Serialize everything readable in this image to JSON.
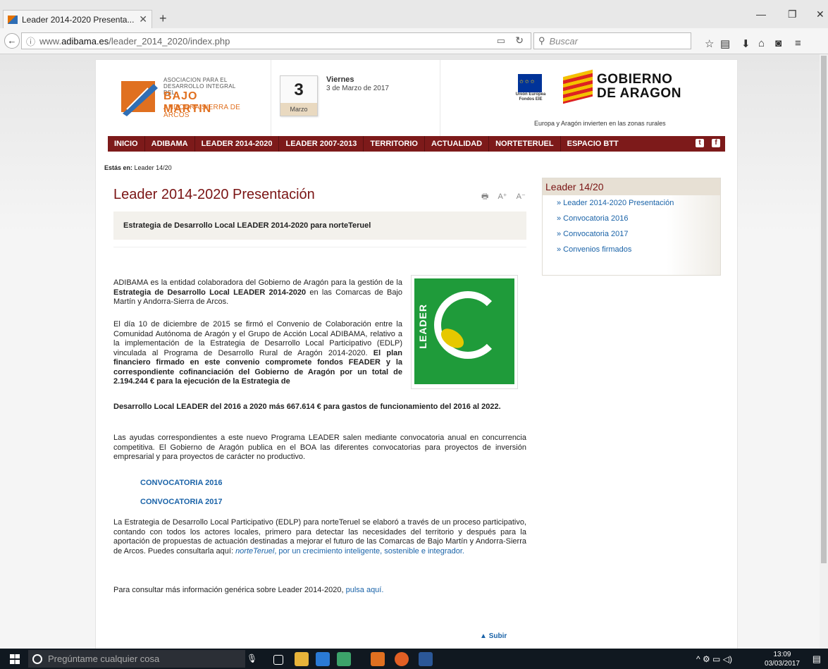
{
  "browser": {
    "tab_title": "Leader 2014-2020 Presenta...",
    "tab_close": "✕",
    "new_tab": "+",
    "url_prefix": "www.",
    "url_domain": "adibama.es",
    "url_path": "/leader_2014_2020/index.php",
    "search_placeholder": "Buscar",
    "win_min": "—",
    "win_max": "❐",
    "win_close": "✕"
  },
  "header": {
    "logo_small_1": "ASOCIACION PARA EL",
    "logo_small_2": "DESARROLLO INTEGRAL DEL",
    "logo_big": "BAJO MARTIN",
    "logo_sub": "ANDORRA SIERRA DE ARCOS",
    "cal_day": "3",
    "cal_month": "Marzo",
    "weekday": "Viernes",
    "full_date": "3 de Marzo de 2017",
    "eu_line1": "Unión Europea",
    "eu_line2": "Fondos EIE",
    "gob_line1": "GOBIERNO",
    "gob_line2": "DE ARAGON",
    "tagline": "Europa y Aragón invierten en las zonas rurales"
  },
  "menu": [
    "INICIO",
    "ADIBAMA",
    "LEADER 2014-2020",
    "LEADER 2007-2013",
    "TERRITORIO",
    "ACTUALIDAD",
    "NORTETERUEL",
    "ESPACIO BTT"
  ],
  "breadcrumb": {
    "label": "Estás en:",
    "current": "Leader 14/20"
  },
  "main": {
    "title": "Leader 2014-2020 Presentación",
    "tool_print": "🖶",
    "tool_bigger": "A⁺",
    "tool_smaller": "A⁻",
    "strategy": "Estrategia de Desarrollo Local LEADER 2014-2020 para norteTeruel",
    "leader_logo_text": "LEADER",
    "p1_a": "ADIBAMA es la entidad colaboradora del Gobierno de Aragón para la gestión de la ",
    "p1_b": "Estrategia de Desarrollo Local LEADER 2014-2020",
    "p1_c": " en las Comarcas de Bajo Martín y Andorra-Sierra de Arcos.",
    "p2_a": "El día 10 de diciembre de 2015 se firmó el Convenio de Colaboración entre la Comunidad Autónoma de Aragón y el Grupo de Acción Local ADIBAMA, relativo a la implementación de la Estrategia de Desarrollo Local Participativo (EDLP) vinculada al Programa de Desarrollo Rural de Aragón 2014-2020.  ",
    "p2_b": "El plan financiero firmado en este convenio compromete fondos FEADER y la correspondiente cofinanciación del Gobierno de Aragón por un total de 2.194.244 € para la ejecución de la Estrategia de",
    "p2_c": "Desarrollo Local LEADER del 2016 a 2020 más 667.614 € para gastos de funcionamiento del 2016 al 2022.",
    "p3": "Las ayudas correspondientes a este nuevo Programa LEADER salen mediante convocatoria anual en concurrencia competitiva.  El Gobierno de Aragón publica en el BOA las diferentes convocatorias para proyectos de inversión empresarial y para proyectos de carácter no productivo.",
    "conv_2016": "CONVOCATORIA 2016",
    "conv_2017": "CONVOCATORIA 2017",
    "p4_a": "La Estrategia de Desarrollo Local Participativo (EDLP) para norteTeruel se elaboró a través de un proceso participativo, contando con todos los actores locales, primero para detectar las necesidades del territorio y después para la aportación de propuestas de actuación destinadas a mejorar el futuro de las Comarcas de Bajo Martín y Andorra-Sierra de Arcos.  Puedes consultarla aquí:  ",
    "p4_link_a": "norteTeruel",
    "p4_link_b": ", por un crecimiento inteligente, sostenible e integrador.",
    "p5_a": "Para consultar más información genérica sobre Leader 2014-2020, ",
    "p5_link": "pulsa aquí.",
    "subir": "Subir"
  },
  "sidebar": {
    "title": "Leader 14/20",
    "items": [
      "» Leader 2014-2020 Presentación",
      "» Convocatoria 2016",
      "» Convocatoria 2017",
      "» Convenios firmados"
    ]
  },
  "taskbar": {
    "search": "Pregúntame cualquier cosa",
    "time": "13:09",
    "date": "03/03/2017"
  }
}
